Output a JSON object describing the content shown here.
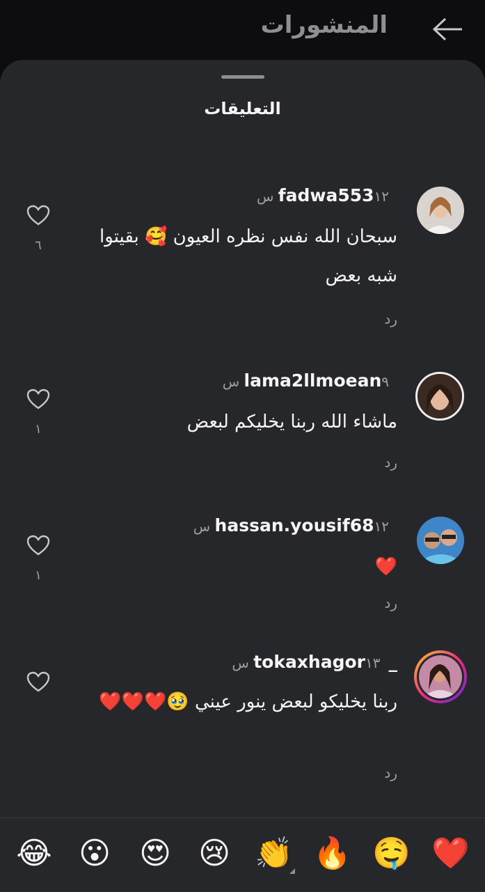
{
  "header": {
    "title": "المنشورات"
  },
  "sheet": {
    "title": "التعليقات"
  },
  "comments": [
    {
      "user": "fadwa553",
      "time": "١٢ س",
      "text": "سبحان الله نفس نظره العيون 🥰 بقيتوا شبه بعض",
      "reply": "رد",
      "likes": "٦"
    },
    {
      "user": "lama2llmoean",
      "time": "٩ س",
      "text": "ماشاء الله ربنا يخليكم لبعض",
      "reply": "رد",
      "likes": "١"
    },
    {
      "user": "hassan.yousif68",
      "time": "١٢ س",
      "text": "❤️",
      "reply": "رد",
      "likes": "١"
    },
    {
      "user": "_tokaxhagor",
      "time": "١٣ س",
      "text": "ربنا يخليكو لبعض ينور عيني 🥹❤️❤️❤️",
      "reply": "رد",
      "likes": ""
    }
  ],
  "reactions": [
    "❤️",
    "🤤",
    "🔥",
    "👏",
    "😢",
    "😍",
    "😮",
    "😂"
  ]
}
